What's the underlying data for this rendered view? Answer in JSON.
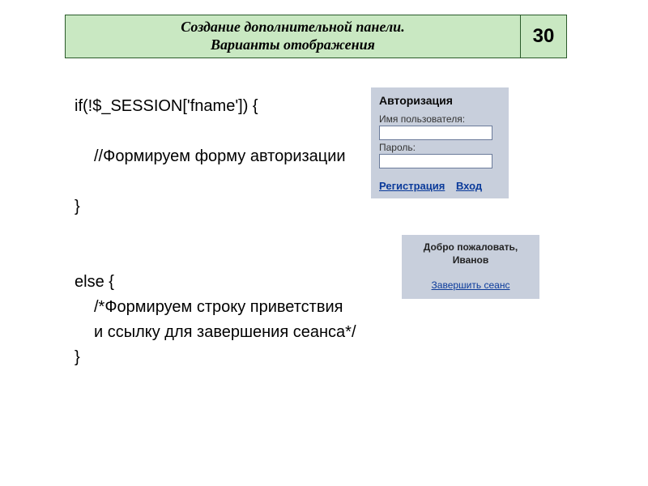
{
  "header": {
    "title_line1": "Создание дополнительной панели.",
    "title_line2": "Варианты отображения",
    "number": "30"
  },
  "code": {
    "l1": "if(!$_SESSION['fname'])  {",
    "l2": "//Формируем форму авторизации",
    "l3": "}",
    "l4": "else  {",
    "l5": "/*Формируем строку приветствия",
    "l6": "и ссылку для завершения сеанса*/",
    "l7": "}"
  },
  "auth": {
    "title": "Авторизация",
    "username_label": "Имя пользователя:",
    "password_label": "Пароль:",
    "register_link": "Регистрация",
    "login_link": "Вход"
  },
  "welcome": {
    "line1": "Добро пожаловать,",
    "line2": "Иванов",
    "logout": "Завершить сеанс"
  }
}
